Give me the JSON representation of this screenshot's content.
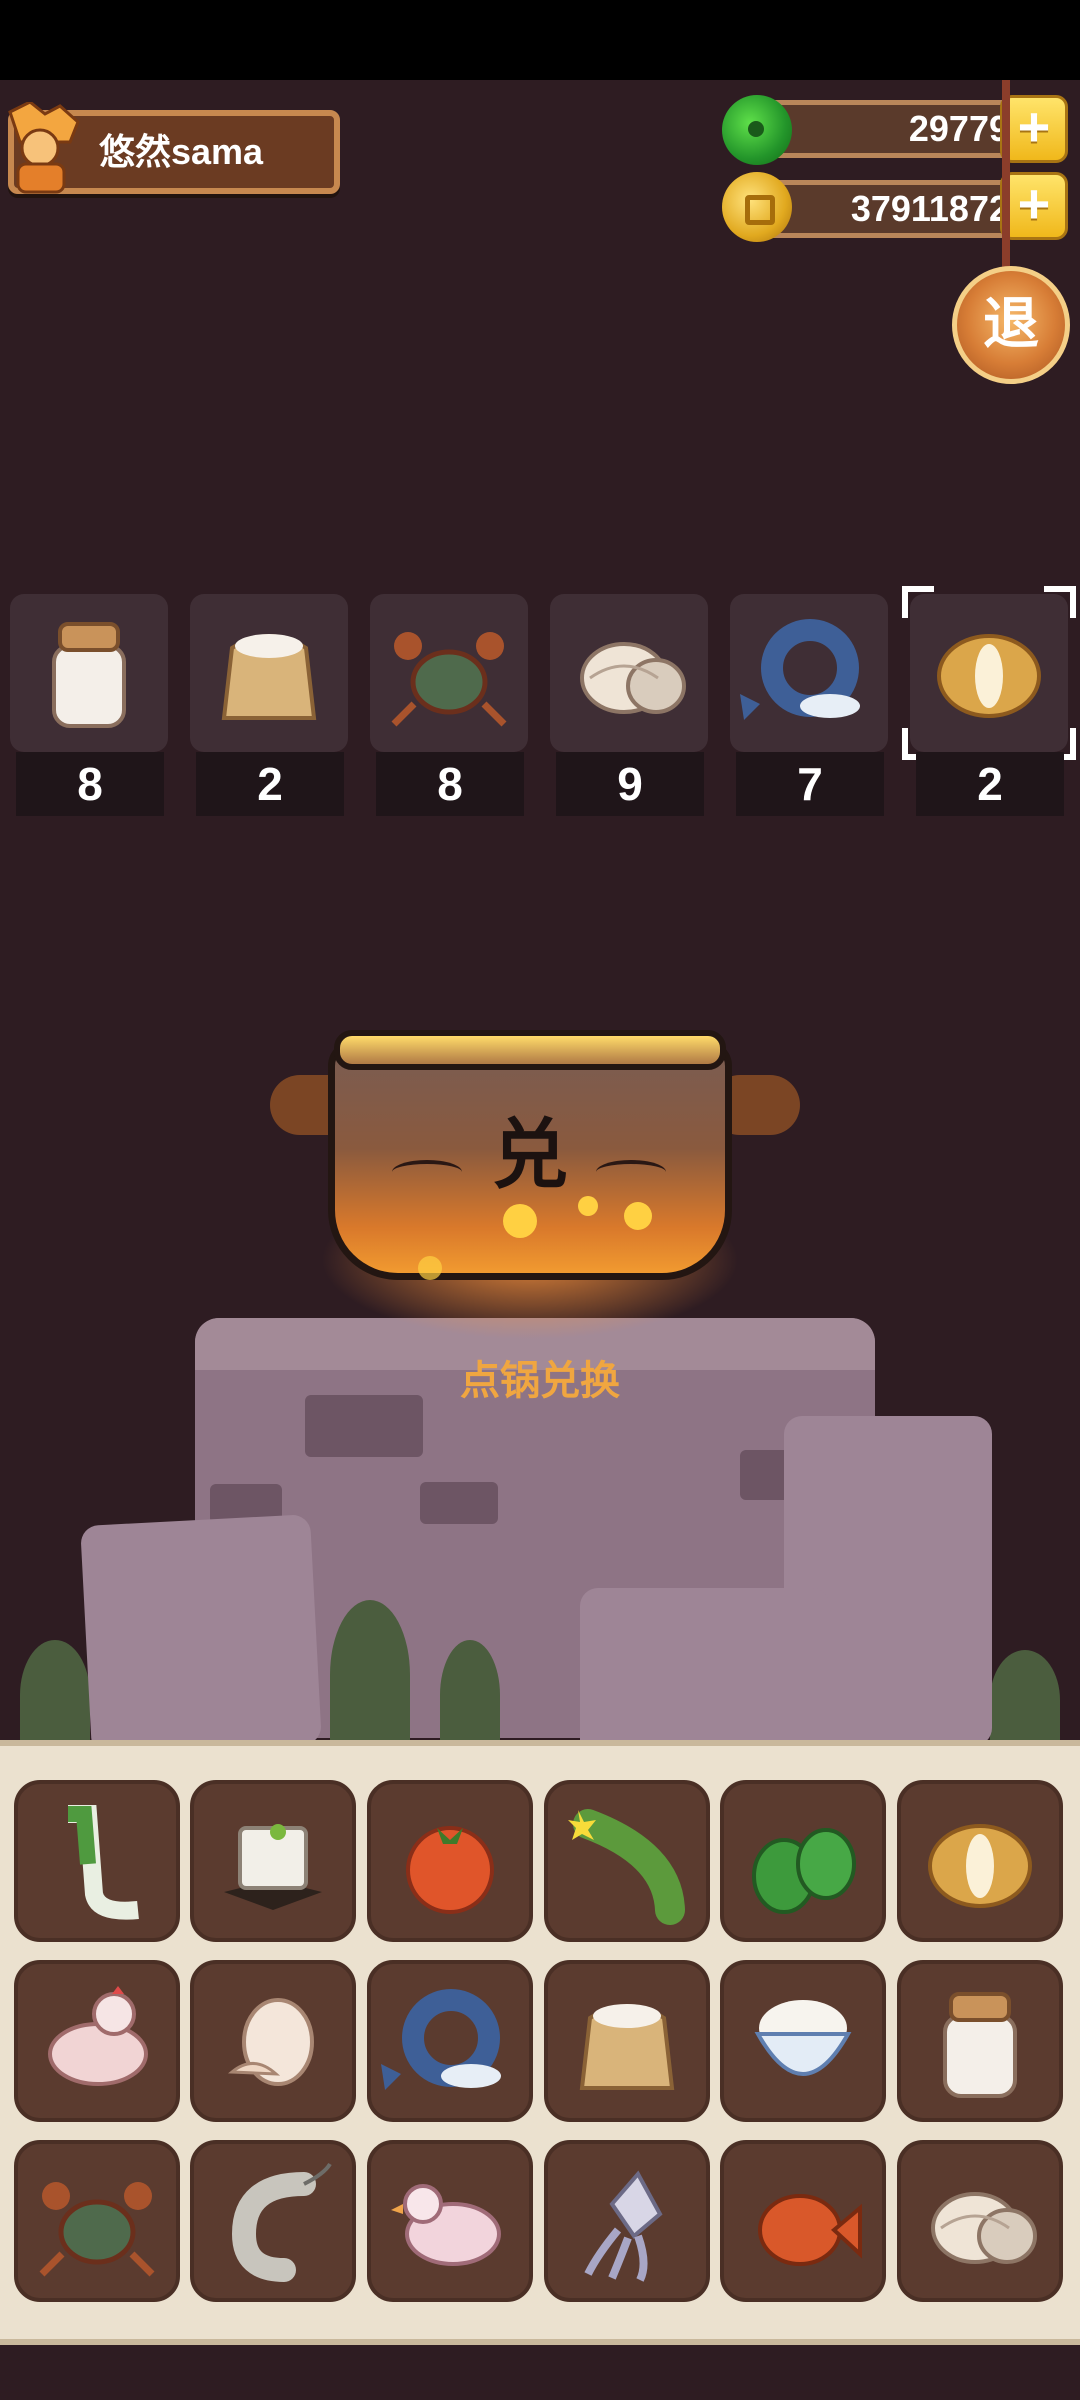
{
  "player": {
    "name": "悠然sama",
    "avatar_icon": "orange-character-avatar-icon"
  },
  "currencies": {
    "jade": {
      "value": "29779",
      "icon": "jade-coin-icon"
    },
    "gold": {
      "value": "37911872",
      "icon": "gold-coin-icon"
    }
  },
  "exit_button": {
    "label": "退"
  },
  "selected_ingredients": [
    {
      "icon": "salt-jar-icon",
      "count": "8"
    },
    {
      "icon": "flour-sack-icon",
      "count": "2"
    },
    {
      "icon": "crab-icon",
      "count": "8"
    },
    {
      "icon": "clam-icon",
      "count": "9"
    },
    {
      "icon": "fish-icon",
      "count": "7"
    },
    {
      "icon": "potato-icon",
      "count": "2",
      "selected": true
    }
  ],
  "pot": {
    "character": "兑",
    "exchange_label": "点锅兑换"
  },
  "inventory": [
    {
      "icon": "leek-icon"
    },
    {
      "icon": "tofu-icon"
    },
    {
      "icon": "tomato-icon"
    },
    {
      "icon": "cucumber-icon"
    },
    {
      "icon": "green-pepper-icon"
    },
    {
      "icon": "potato-icon"
    },
    {
      "icon": "chicken-icon"
    },
    {
      "icon": "egg-icon"
    },
    {
      "icon": "fish-icon"
    },
    {
      "icon": "flour-sack-icon"
    },
    {
      "icon": "rice-bowl-icon"
    },
    {
      "icon": "salt-jar-icon"
    },
    {
      "icon": "crab-icon"
    },
    {
      "icon": "shrimp-icon"
    },
    {
      "icon": "duck-icon"
    },
    {
      "icon": "squid-icon"
    },
    {
      "icon": "red-fish-icon"
    },
    {
      "icon": "clam-icon"
    }
  ]
}
